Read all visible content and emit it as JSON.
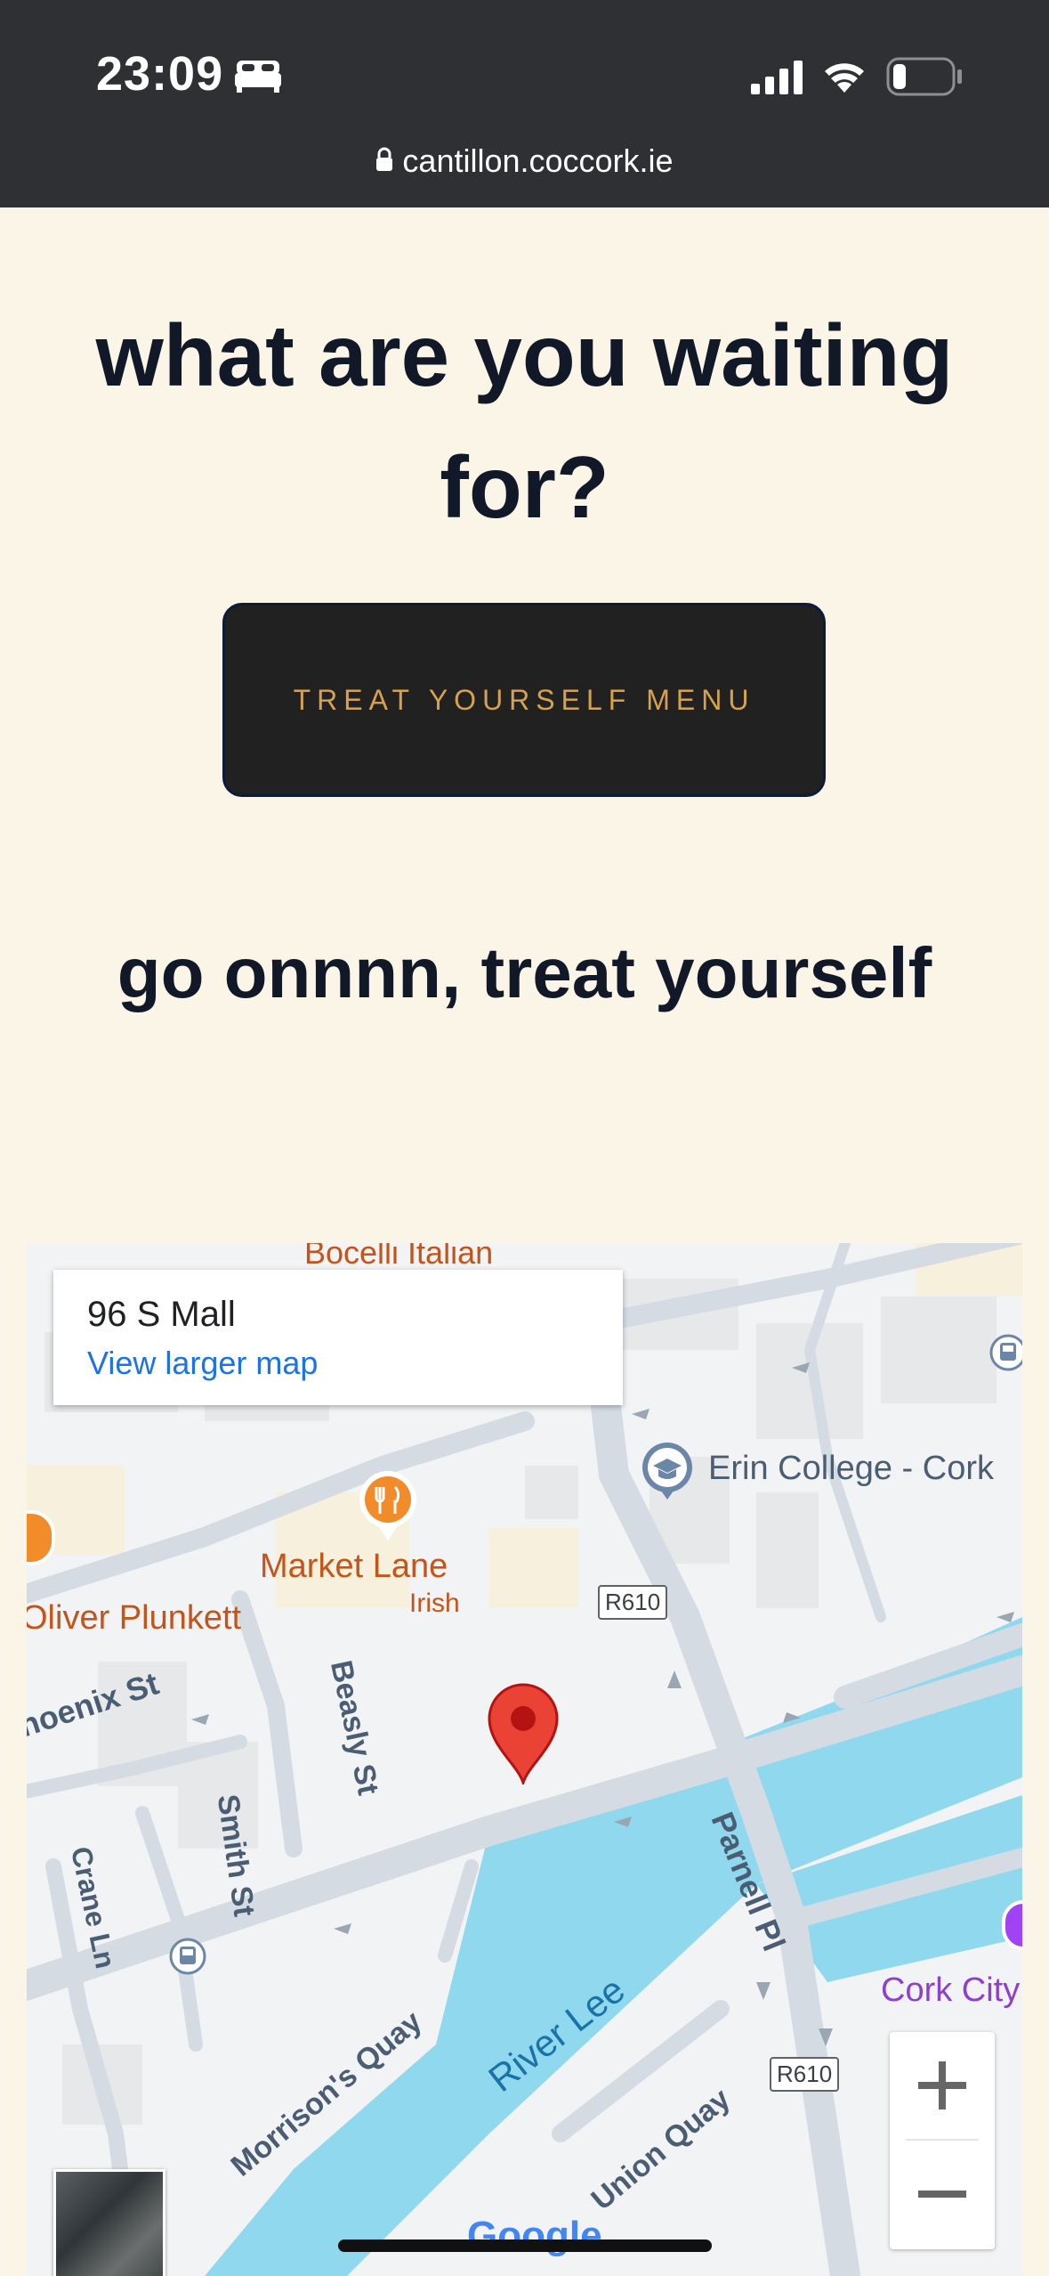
{
  "status_bar": {
    "time": "23:09",
    "url": "cantillon.coccork.ie",
    "icons": [
      "bed-icon",
      "signal-icon",
      "wifi-icon",
      "battery-icon",
      "lock-icon"
    ]
  },
  "hero": {
    "headline_line1": "what are you waiting",
    "headline_line2": "for?",
    "cta_label": "TREAT YOURSELF MENU",
    "subheadline": "go onnnn, treat yourself"
  },
  "map": {
    "place_title": "96 S Mall",
    "larger_map_link": "View larger map",
    "labels": {
      "boceli": "Bocelli Italian",
      "erin_college": "Erin College - Cork",
      "market_lane": "Market Lane",
      "market_lane_sub": "Irish",
      "oliver_plunkett": "Oliver Plunkett",
      "r610": "R610",
      "phoenix_st": "Phoenix St",
      "beasly_st": "Beasly St",
      "smith_st": "Smith St",
      "crane_ln": "Crane Ln",
      "parnell_pl": "Parnell Pl",
      "river_lee": "River Lee",
      "morrisons_quay": "Morrison's Quay",
      "union_quay": "Union Quay",
      "cork_city": "Cork City",
      "google": "Google"
    },
    "zoom_in_label": "+",
    "zoom_out_label": "−",
    "colors": {
      "water": "#8fd8ee",
      "road": "#d4dbe3",
      "land": "#f1f3f4",
      "pin": "#ea4335",
      "poi_orange": "#c5541a"
    }
  }
}
